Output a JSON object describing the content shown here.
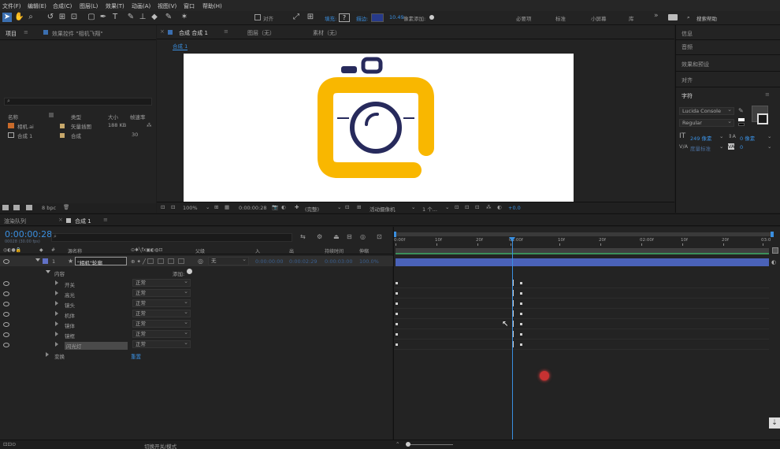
{
  "menu": [
    "文件(F)",
    "编辑(E)",
    "合成(C)",
    "图层(L)",
    "效果(T)",
    "动画(A)",
    "视图(V)",
    "窗口",
    "帮助(H)"
  ],
  "toolbar": {
    "align_label": "对齐",
    "fill_label": "填充:",
    "stroke_label": "描边:",
    "stroke_value": "10.49",
    "add_label": "像素添加:",
    "workspaces": [
      "必要项",
      "标准",
      "小屏幕",
      "库"
    ],
    "search_placeholder": "搜索帮助"
  },
  "project": {
    "tab": "项目",
    "effects_tab": "效果控件 \"相机飞翔\"",
    "search_placeholder": "",
    "columns": [
      "名称",
      "类型",
      "大小",
      "帧速率"
    ],
    "items": [
      {
        "name": "相机.ai",
        "type": "矢量插图",
        "size": "188 KB",
        "fps": ""
      },
      {
        "name": "合成 1",
        "type": "合成",
        "size": "",
        "fps": "30"
      }
    ],
    "bpc": "8 bpc"
  },
  "composition": {
    "tab": "合成 合成 1",
    "layer_tab": "图层（无）",
    "footage_tab": "素材（无）",
    "breadcrumb": "合成 1",
    "zoom": "100%",
    "timecode": "0:00:00:28",
    "quality": "(完整)",
    "camera": "活动摄像机",
    "views": "1 个...",
    "exposure": "+0.0"
  },
  "right_panel": {
    "items": [
      "信息",
      "音频",
      "效果和预设",
      "对齐",
      "字符"
    ],
    "font": "Lucida Console",
    "style": "Regular",
    "font_size": "249 像素",
    "leading": "0 像素",
    "tracking": "度量标准",
    "kerning": "0"
  },
  "timeline": {
    "render_tab": "渲染队列",
    "comp_tab": "合成 1",
    "timecode": "0:00:00:28",
    "timecode_sub": "00028 (30.00 fps)",
    "layer_columns": [
      "源名称",
      "父级",
      "入",
      "出",
      "持续时间",
      "伸缩"
    ],
    "layer": {
      "num": "1",
      "name": "\"相机\"轮廓",
      "parent": "无",
      "in": "0:00:00:00",
      "out": "0:00:02:29",
      "duration": "0:00:03:00",
      "stretch": "100.0%"
    },
    "contents_label": "内容",
    "add_label": "添加:",
    "groups": [
      {
        "name": "开关",
        "mode": "正常"
      },
      {
        "name": "高光",
        "mode": "正常"
      },
      {
        "name": "镜头",
        "mode": "正常"
      },
      {
        "name": "机体",
        "mode": "正常"
      },
      {
        "name": "镜体",
        "mode": "正常"
      },
      {
        "name": "镜框",
        "mode": "正常"
      },
      {
        "name": "闪光灯",
        "mode": "正常"
      }
    ],
    "transform_label": "变换",
    "reset_label": "重置",
    "ruler": [
      "0:00f",
      "10f",
      "20f",
      "01:00f",
      "10f",
      "20f",
      "02:00f",
      "10f",
      "20f",
      "03:0"
    ],
    "bottom_label": "切换开关/模式"
  },
  "colors": {
    "accent": "#3a8fe0",
    "camera_yellow": "#f9b700",
    "camera_navy": "#272a5c",
    "layer_bar": "#4a62b8"
  }
}
